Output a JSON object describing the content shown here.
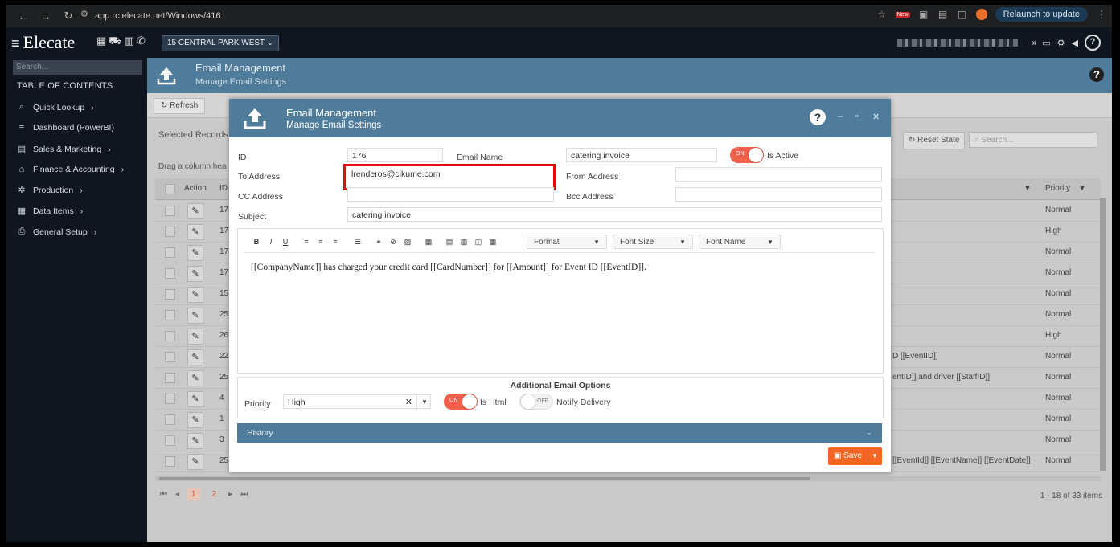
{
  "browser": {
    "url": "app.rc.elecate.net/Windows/416",
    "relaunch": "Relaunch to update",
    "new_badge": "New"
  },
  "app": {
    "logo": "Elecate",
    "location": "15 CENTRAL PARK WEST"
  },
  "sidebar": {
    "search_placeholder": "Search...",
    "toc": "TABLE OF CONTENTS",
    "items": [
      {
        "label": "Quick Lookup",
        "icon": "search-icon"
      },
      {
        "label": "Dashboard (PowerBI)",
        "icon": "menu-icon"
      },
      {
        "label": "Sales & Marketing",
        "icon": "store-icon"
      },
      {
        "label": "Finance & Accounting",
        "icon": "bank-icon"
      },
      {
        "label": "Production",
        "icon": "gear-icon"
      },
      {
        "label": "Data Items",
        "icon": "grid-icon"
      },
      {
        "label": "General Setup",
        "icon": "printer-icon"
      }
    ]
  },
  "page": {
    "title": "Email Management",
    "subtitle": "Manage Email Settings"
  },
  "toolbar": {
    "refresh": "Refresh"
  },
  "grid": {
    "selected_records": "Selected Records",
    "drag_hint": "Drag a column hea",
    "reset_state": "Reset State",
    "search_placeholder": "Search...",
    "col_action": "Action",
    "col_id": "ID",
    "col_priority": "Priority",
    "rows": [
      {
        "id": "17",
        "priority": "Normal",
        "tail": ""
      },
      {
        "id": "17",
        "priority": "High",
        "tail": ""
      },
      {
        "id": "17",
        "priority": "Normal",
        "tail": ""
      },
      {
        "id": "17",
        "priority": "Normal",
        "tail": ""
      },
      {
        "id": "15",
        "priority": "Normal",
        "tail": ""
      },
      {
        "id": "25",
        "priority": "Normal",
        "tail": ""
      },
      {
        "id": "26",
        "priority": "High",
        "tail": ""
      },
      {
        "id": "22",
        "priority": "Normal",
        "tail": "D [[EventID]]"
      },
      {
        "id": "25",
        "priority": "Normal",
        "tail": "entID]] and driver [[StaffID]]"
      },
      {
        "id": "4",
        "priority": "Normal",
        "tail": ""
      },
      {
        "id": "1",
        "priority": "Normal",
        "tail": ""
      },
      {
        "id": "3",
        "priority": "Normal",
        "tail": ""
      },
      {
        "id": "25",
        "priority": "Normal",
        "tail": "[[EventId]] [[EventName]] [[EventDate]]"
      }
    ],
    "pager": {
      "p1": "1",
      "p2": "2"
    },
    "count": "1 - 18 of 33 items"
  },
  "modal": {
    "title": "Email Management",
    "subtitle": "Manage Email Settings",
    "id_label": "ID",
    "id_value": "176",
    "email_name_label": "Email Name",
    "email_name_value": "catering invoice",
    "is_active_label": "Is Active",
    "is_active": true,
    "to_label": "To Address",
    "to_value": "lrenderos@cikume.com",
    "from_label": "From Address",
    "from_value": "",
    "cc_label": "CC Address",
    "cc_value": "",
    "bcc_label": "Bcc Address",
    "bcc_value": "",
    "subject_label": "Subject",
    "subject_value": "catering invoice",
    "editor": {
      "format": "Format",
      "font_size": "Font Size",
      "font_name": "Font Name",
      "body": "[[CompanyName]] has charged your credit card [[CardNumber]] for [[Amount]] for Event ID [[EventID]]."
    },
    "additional": {
      "title": "Additional Email Options",
      "priority_label": "Priority",
      "priority_value": "High",
      "is_html_label": "Is Html",
      "is_html": true,
      "notify_label": "Notify Delivery",
      "notify": false
    },
    "history": "History",
    "save": "Save",
    "toggle_on": "ON",
    "toggle_off": "OFF"
  },
  "colors": {
    "header_blue": "#4f7c9b",
    "accent_orange": "#f26522",
    "toggle_on": "#f0604a",
    "highlight_red": "#e10e0e"
  }
}
